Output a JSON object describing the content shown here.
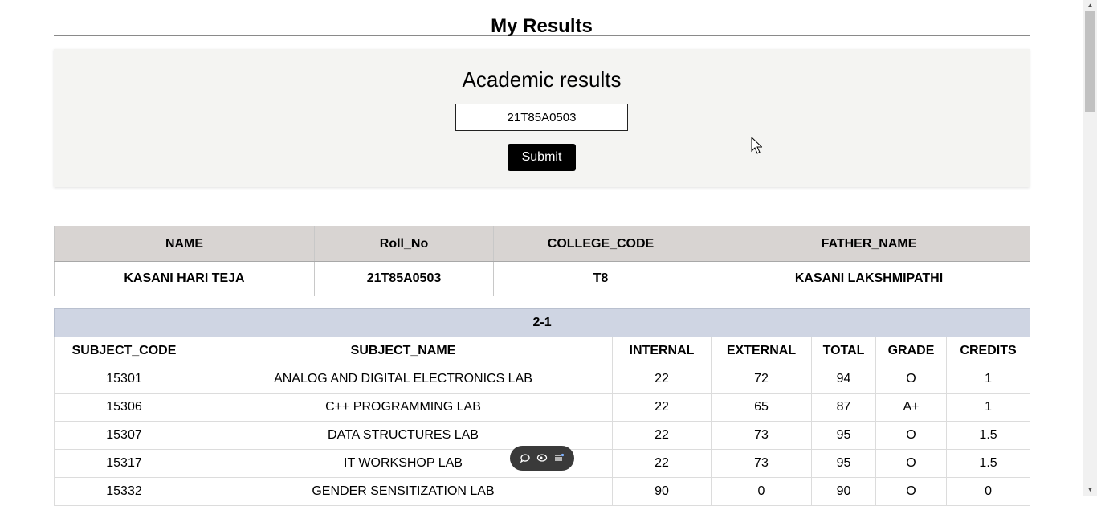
{
  "page": {
    "title": "My Results"
  },
  "search": {
    "heading": "Academic results",
    "roll_value": "21T85A0503",
    "submit_label": "Submit"
  },
  "student": {
    "headers": [
      "NAME",
      "Roll_No",
      "COLLEGE_CODE",
      "FATHER_NAME"
    ],
    "values": [
      "KASANI HARI TEJA",
      "21T85A0503",
      "T8",
      "KASANI LAKSHMIPATHI"
    ]
  },
  "semester": {
    "label": "2-1",
    "headers": [
      "SUBJECT_CODE",
      "SUBJECT_NAME",
      "INTERNAL",
      "EXTERNAL",
      "TOTAL",
      "GRADE",
      "CREDITS"
    ],
    "rows": [
      [
        "15301",
        "ANALOG AND DIGITAL ELECTRONICS LAB",
        "22",
        "72",
        "94",
        "O",
        "1"
      ],
      [
        "15306",
        "C++ PROGRAMMING LAB",
        "22",
        "65",
        "87",
        "A+",
        "1"
      ],
      [
        "15307",
        "DATA STRUCTURES LAB",
        "22",
        "73",
        "95",
        "O",
        "1.5"
      ],
      [
        "15317",
        "IT WORKSHOP LAB",
        "22",
        "73",
        "95",
        "O",
        "1.5"
      ],
      [
        "15332",
        "GENDER SENSITIZATION LAB",
        "90",
        "0",
        "90",
        "O",
        "0"
      ]
    ]
  },
  "toolbar": {
    "icons": [
      "chat-icon",
      "eye-icon",
      "list-icon"
    ]
  },
  "colors": {
    "student_header_bg": "#d8d4d2",
    "semester_header_bg": "#cfd5e3",
    "card_bg": "#f4f4f2",
    "button_bg": "#000000"
  }
}
